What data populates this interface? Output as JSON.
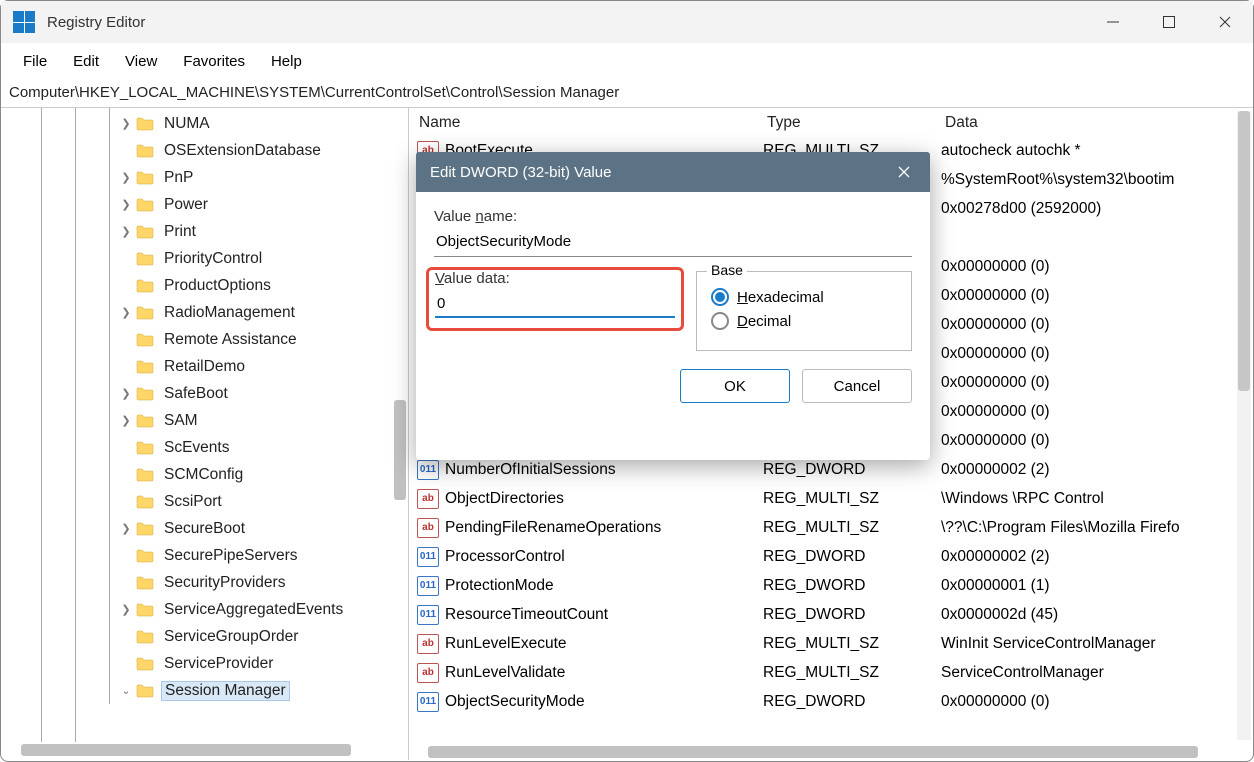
{
  "window": {
    "title": "Registry Editor"
  },
  "menu": {
    "file": "File",
    "edit": "Edit",
    "view": "View",
    "favorites": "Favorites",
    "help": "Help"
  },
  "address": "Computer\\HKEY_LOCAL_MACHINE\\SYSTEM\\CurrentControlSet\\Control\\Session Manager",
  "tree": [
    {
      "chev": ">",
      "label": "NUMA"
    },
    {
      "chev": "",
      "label": "OSExtensionDatabase"
    },
    {
      "chev": ">",
      "label": "PnP"
    },
    {
      "chev": ">",
      "label": "Power"
    },
    {
      "chev": ">",
      "label": "Print"
    },
    {
      "chev": "",
      "label": "PriorityControl"
    },
    {
      "chev": "",
      "label": "ProductOptions"
    },
    {
      "chev": ">",
      "label": "RadioManagement"
    },
    {
      "chev": "",
      "label": "Remote Assistance"
    },
    {
      "chev": "",
      "label": "RetailDemo"
    },
    {
      "chev": ">",
      "label": "SafeBoot"
    },
    {
      "chev": ">",
      "label": "SAM"
    },
    {
      "chev": "",
      "label": "ScEvents"
    },
    {
      "chev": "",
      "label": "SCMConfig"
    },
    {
      "chev": "",
      "label": "ScsiPort"
    },
    {
      "chev": ">",
      "label": "SecureBoot"
    },
    {
      "chev": "",
      "label": "SecurePipeServers"
    },
    {
      "chev": "",
      "label": "SecurityProviders"
    },
    {
      "chev": ">",
      "label": "ServiceAggregatedEvents"
    },
    {
      "chev": "",
      "label": "ServiceGroupOrder"
    },
    {
      "chev": "",
      "label": "ServiceProvider"
    },
    {
      "chev": "v",
      "label": "Session Manager",
      "selected": true
    }
  ],
  "cols": {
    "name": "Name",
    "type": "Type",
    "data": "Data"
  },
  "rows": [
    {
      "icon": "sz",
      "name": "BootExecute",
      "type": "REG_MULTI_SZ",
      "data": "autocheck autochk *"
    },
    {
      "icon": "sz",
      "name": "",
      "type": "",
      "data": "%SystemRoot%\\system32\\bootim"
    },
    {
      "icon": "bin",
      "name": "",
      "type": "",
      "data": "0x00278d00 (2592000)"
    },
    {
      "icon": "sz",
      "name": "",
      "type": "",
      "data": ""
    },
    {
      "icon": "bin",
      "name": "",
      "type": "",
      "data": "0x00000000 (0)"
    },
    {
      "icon": "sz",
      "name": "",
      "type": "",
      "data": "0x00000000 (0)"
    },
    {
      "icon": "bin",
      "name": "",
      "type": "",
      "data": "0x00000000 (0)"
    },
    {
      "icon": "sz",
      "name": "",
      "type": "",
      "data": "0x00000000 (0)"
    },
    {
      "icon": "sz",
      "name": "",
      "type": "",
      "data": "0x00000000 (0)"
    },
    {
      "icon": "sz",
      "name": "",
      "type": "",
      "data": "0x00000000 (0)"
    },
    {
      "icon": "bin",
      "name": "",
      "type": "",
      "data": "0x00000000 (0)"
    },
    {
      "icon": "bin",
      "name": "NumberOfInitialSessions",
      "type": "REG_DWORD",
      "data": "0x00000002 (2)"
    },
    {
      "icon": "sz",
      "name": "ObjectDirectories",
      "type": "REG_MULTI_SZ",
      "data": "\\Windows \\RPC Control"
    },
    {
      "icon": "sz",
      "name": "PendingFileRenameOperations",
      "type": "REG_MULTI_SZ",
      "data": "\\??\\C:\\Program Files\\Mozilla Firefo"
    },
    {
      "icon": "bin",
      "name": "ProcessorControl",
      "type": "REG_DWORD",
      "data": "0x00000002 (2)"
    },
    {
      "icon": "bin",
      "name": "ProtectionMode",
      "type": "REG_DWORD",
      "data": "0x00000001 (1)"
    },
    {
      "icon": "bin",
      "name": "ResourceTimeoutCount",
      "type": "REG_DWORD",
      "data": "0x0000002d (45)"
    },
    {
      "icon": "sz",
      "name": "RunLevelExecute",
      "type": "REG_MULTI_SZ",
      "data": "WinInit ServiceControlManager"
    },
    {
      "icon": "sz",
      "name": "RunLevelValidate",
      "type": "REG_MULTI_SZ",
      "data": "ServiceControlManager"
    },
    {
      "icon": "bin",
      "name": "ObjectSecurityMode",
      "type": "REG_DWORD",
      "data": "0x00000000 (0)"
    }
  ],
  "dialog": {
    "title": "Edit DWORD (32-bit) Value",
    "value_name_label": "Value name:",
    "value_name_underline": "n",
    "value_name": "ObjectSecurityMode",
    "value_data_label": "Value data:",
    "value_data_underline": "V",
    "value_data": "0",
    "base_label": "Base",
    "hex": "Hexadecimal",
    "dec": "Decimal",
    "ok": "OK",
    "cancel": "Cancel"
  }
}
